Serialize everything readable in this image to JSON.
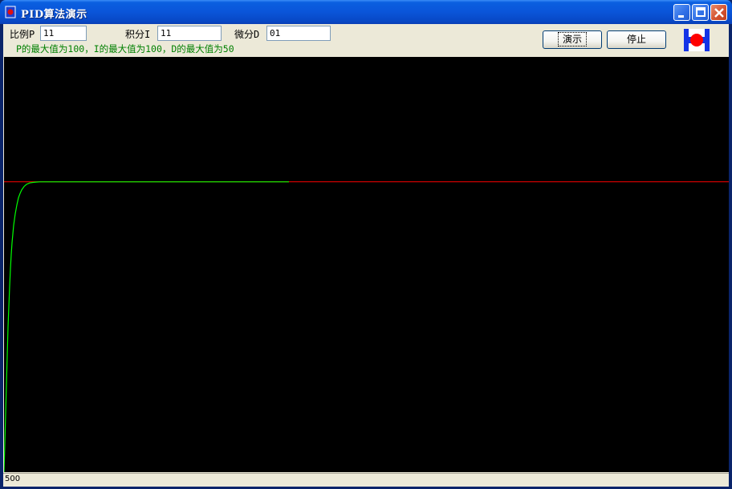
{
  "window": {
    "title": "PID算法演示",
    "title_icon": "pid-app-icon",
    "controls": {
      "minimize": "minimize-icon",
      "maximize": "maximize-icon",
      "close": "close-icon"
    }
  },
  "params": {
    "p_label": "比例P",
    "p_value": "11",
    "i_label": "积分I",
    "i_value": "11",
    "d_label": "微分D",
    "d_value": "01",
    "hint": "P的最大值为100，I的最大值为100，D的最大值为50"
  },
  "toolbar": {
    "demo_label": "演示",
    "stop_label": "停止",
    "logo_icon": "record-logo-icon"
  },
  "status": {
    "text": "500"
  },
  "chart_data": {
    "type": "line",
    "background": "#000000",
    "setpoint": {
      "color": "#ff0000"
    },
    "response": {
      "color": "#00ff00",
      "x": [
        0,
        1,
        2,
        3,
        4,
        5,
        6,
        7,
        8,
        9,
        10,
        12,
        14,
        16,
        18,
        20,
        22,
        25,
        28,
        32,
        36,
        40,
        45,
        50,
        60,
        80,
        120,
        200,
        300,
        355
      ],
      "y": [
        0.0,
        0.1,
        0.2,
        0.3,
        0.4,
        0.5,
        0.57,
        0.64,
        0.7,
        0.75,
        0.79,
        0.85,
        0.89,
        0.92,
        0.945,
        0.96,
        0.972,
        0.984,
        0.991,
        0.996,
        0.998,
        0.999,
        1.0,
        1.0,
        1.0,
        1.0,
        1.0,
        1.0,
        1.0,
        1.0
      ]
    },
    "xlim": [
      0,
      903
    ],
    "ylim": [
      0,
      1.43
    ]
  }
}
